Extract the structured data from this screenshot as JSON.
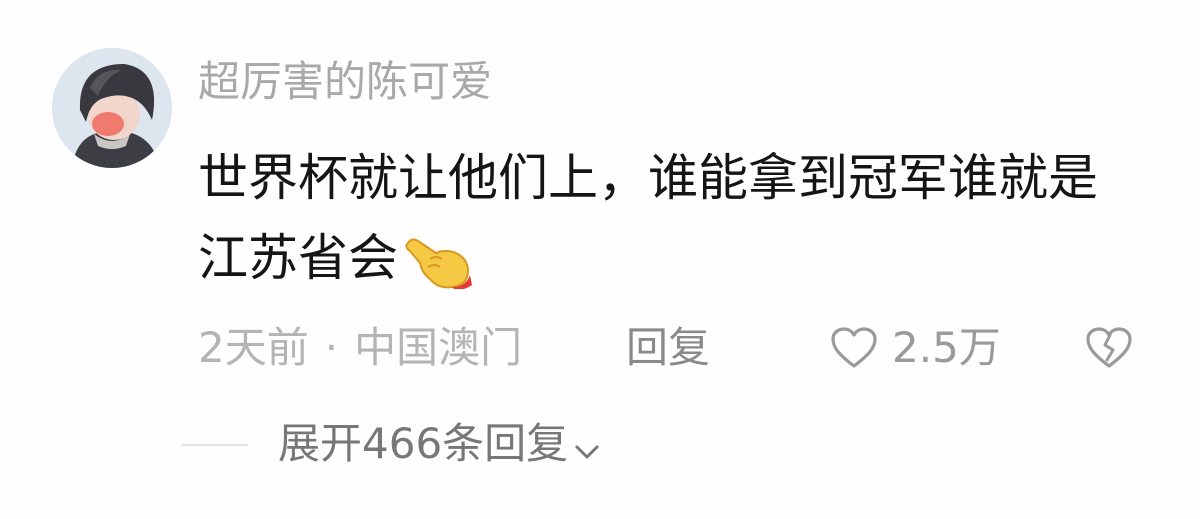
{
  "comment": {
    "username": "超厉害的陈可爱",
    "content": "世界杯就让他们上，谁能拿到冠军谁就是江苏省会",
    "content_emoji": "pointing-hand-emoji",
    "time": "2天前",
    "separator": "·",
    "location": "中国澳门",
    "reply_label": "回复",
    "like_count": "2.5万",
    "icons": {
      "like": "heart-outline-icon",
      "dislike": "broken-heart-icon",
      "expand": "chevron-down-icon"
    }
  },
  "expand_replies": {
    "label": "展开466条回复"
  },
  "colors": {
    "background": "#fefefe",
    "username": "#a9a9a9",
    "content": "#151515",
    "meta": "#b4b4b4"
  }
}
